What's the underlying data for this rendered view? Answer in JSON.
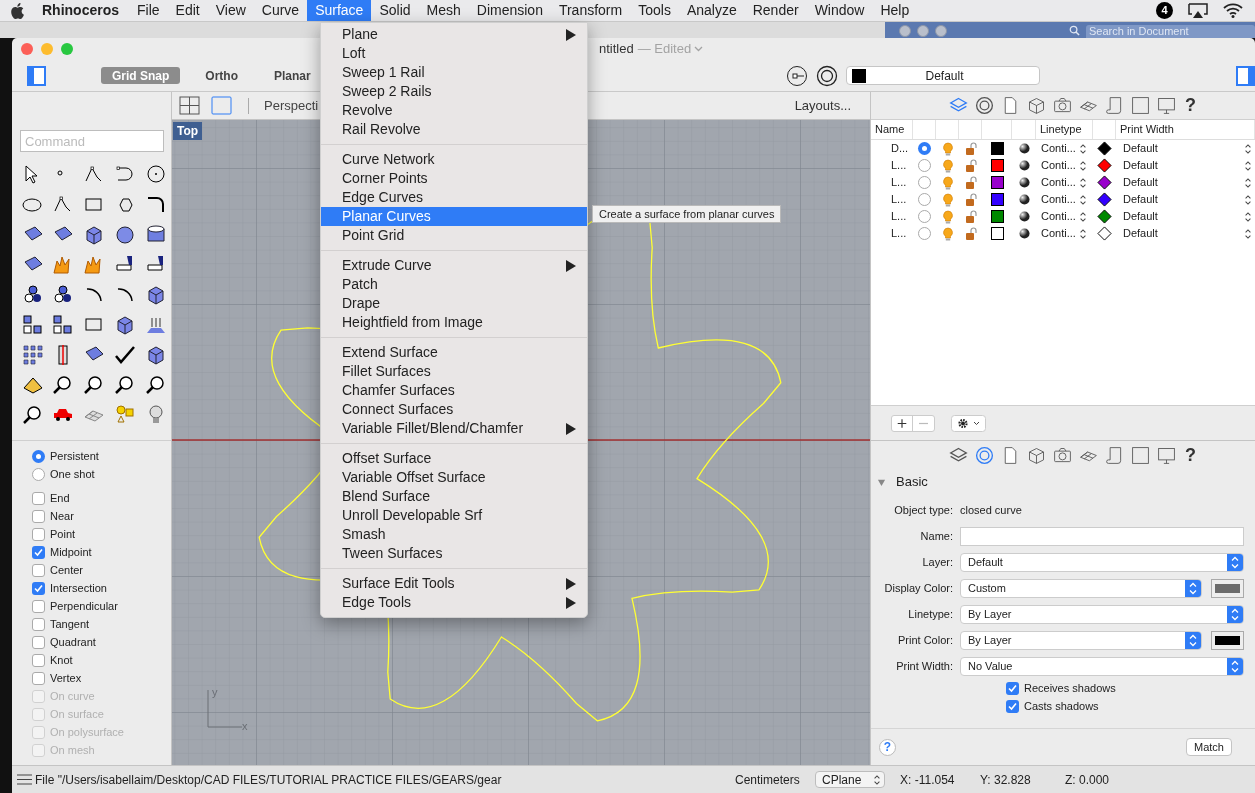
{
  "menu_bar": {
    "app": "Rhinoceros",
    "items": [
      {
        "label": "File",
        "selected": false
      },
      {
        "label": "Edit",
        "selected": false
      },
      {
        "label": "View",
        "selected": false
      },
      {
        "label": "Curve",
        "selected": false
      },
      {
        "label": "Surface",
        "selected": true
      },
      {
        "label": "Solid",
        "selected": false
      },
      {
        "label": "Mesh",
        "selected": false
      },
      {
        "label": "Dimension",
        "selected": false
      },
      {
        "label": "Transform",
        "selected": false
      },
      {
        "label": "Tools",
        "selected": false
      },
      {
        "label": "Analyze",
        "selected": false
      },
      {
        "label": "Render",
        "selected": false
      },
      {
        "label": "Window",
        "selected": false
      },
      {
        "label": "Help",
        "selected": false
      }
    ],
    "notification_count": "4"
  },
  "background_window": {
    "search_placeholder": "Search in Document"
  },
  "window": {
    "title": "ntitled",
    "status": "— Edited"
  },
  "toolbar": {
    "toggles": [
      {
        "label": "Grid Snap",
        "on": true
      },
      {
        "label": "Ortho",
        "on": false
      },
      {
        "label": "Planar",
        "on": false
      }
    ],
    "layer": {
      "label": "Default",
      "color": "#000000"
    }
  },
  "command": {
    "placeholder": "Command"
  },
  "osnap": {
    "modes": [
      {
        "label": "Persistent",
        "selected": true
      },
      {
        "label": "One shot",
        "selected": false
      }
    ],
    "snaps": [
      {
        "label": "End",
        "checked": false,
        "disabled": false
      },
      {
        "label": "Near",
        "checked": false,
        "disabled": false
      },
      {
        "label": "Point",
        "checked": false,
        "disabled": false
      },
      {
        "label": "Midpoint",
        "checked": true,
        "disabled": false
      },
      {
        "label": "Center",
        "checked": false,
        "disabled": false
      },
      {
        "label": "Intersection",
        "checked": true,
        "disabled": false
      },
      {
        "label": "Perpendicular",
        "checked": false,
        "disabled": false
      },
      {
        "label": "Tangent",
        "checked": false,
        "disabled": false
      },
      {
        "label": "Quadrant",
        "checked": false,
        "disabled": false
      },
      {
        "label": "Knot",
        "checked": false,
        "disabled": false
      },
      {
        "label": "Vertex",
        "checked": false,
        "disabled": false
      },
      {
        "label": "On curve",
        "checked": false,
        "disabled": true
      },
      {
        "label": "On surface",
        "checked": false,
        "disabled": true
      },
      {
        "label": "On polysurface",
        "checked": false,
        "disabled": true
      },
      {
        "label": "On mesh",
        "checked": false,
        "disabled": true
      }
    ]
  },
  "viewport": {
    "views": [
      {
        "selected": false
      },
      {
        "selected": true
      }
    ],
    "tab": "Perspecti",
    "layouts": "Layouts...",
    "name": "Top",
    "axis_x": "x",
    "axis_y": "y"
  },
  "layers": {
    "tabs": [
      {
        "selected": true
      },
      {
        "selected": false
      },
      {
        "selected": false
      },
      {
        "selected": false
      },
      {
        "selected": false
      },
      {
        "selected": false
      },
      {
        "selected": false
      },
      {
        "selected": false
      },
      {
        "selected": false
      }
    ],
    "help": "?",
    "columns": [
      "Name",
      "Linetype",
      "Print Width"
    ],
    "rows": [
      {
        "name": "D...",
        "current": true,
        "color": "#000000",
        "linetype": "Conti...",
        "print_color": {
          "color": "#000000"
        },
        "print_width": "Default"
      },
      {
        "name": "L...",
        "current": false,
        "color": "#ff0000",
        "linetype": "Conti...",
        "print_color": {
          "color": "#ff0000"
        },
        "print_width": "Default"
      },
      {
        "name": "L...",
        "current": false,
        "color": "#9900cc",
        "linetype": "Conti...",
        "print_color": {
          "color": "#9900cc"
        },
        "print_width": "Default"
      },
      {
        "name": "L...",
        "current": false,
        "color": "#3300ff",
        "linetype": "Conti...",
        "print_color": {
          "color": "#3300ff"
        },
        "print_width": "Default"
      },
      {
        "name": "L...",
        "current": false,
        "color": "#008800",
        "linetype": "Conti...",
        "print_color": {
          "color": "#008800"
        },
        "print_width": "Default"
      },
      {
        "name": "L...",
        "current": false,
        "color": "#ffffff",
        "linetype": "Conti...",
        "print_color": {
          "color": "#ffffff"
        },
        "print_width": "Default"
      }
    ]
  },
  "properties": {
    "tabs": [
      {
        "selected": false
      },
      {
        "selected": true
      },
      {
        "selected": false
      },
      {
        "selected": false
      },
      {
        "selected": false
      },
      {
        "selected": false
      },
      {
        "selected": false
      },
      {
        "selected": false
      },
      {
        "selected": false
      }
    ],
    "help": "?",
    "section": "Basic",
    "expanded": true,
    "object_type_label": "Object type:",
    "object_type": "closed curve",
    "fields": [
      {
        "label": "Name:",
        "kind": "text"
      },
      {
        "label": "Layer:",
        "kind": "select",
        "value": "Default"
      },
      {
        "label": "Display Color:",
        "kind": "select",
        "value": "Custom",
        "swatch": {
          "color": "#6b6b6b"
        }
      },
      {
        "label": "Linetype:",
        "kind": "select",
        "value": "By Layer"
      },
      {
        "label": "Print Color:",
        "kind": "select",
        "value": "By Layer",
        "swatch": {
          "color": "#000000"
        }
      },
      {
        "label": "Print Width:",
        "kind": "select",
        "value": "No Value"
      }
    ],
    "checkboxes": [
      {
        "label": "Receives shadows",
        "checked": true
      },
      {
        "label": "Casts shadows",
        "checked": true
      }
    ],
    "help_button": "?",
    "button": "Match"
  },
  "status_bar": {
    "file": "File \"/Users/isabellaim/Desktop/CAD FILES/TUTORIAL PRACTICE FILES/GEARS/gear",
    "units": "Centimeters",
    "cplane": "CPlane",
    "x": "X: -11.054",
    "y": "Y: 32.828",
    "z": "Z: 0.000"
  },
  "surface_menu": {
    "groups": [
      [
        {
          "label": "Plane",
          "submenu": true,
          "selected": false
        },
        {
          "label": "Loft",
          "submenu": false,
          "selected": false
        },
        {
          "label": "Sweep 1 Rail",
          "submenu": false,
          "selected": false
        },
        {
          "label": "Sweep 2 Rails",
          "submenu": false,
          "selected": false
        },
        {
          "label": "Revolve",
          "submenu": false,
          "selected": false
        },
        {
          "label": "Rail Revolve",
          "submenu": false,
          "selected": false
        }
      ],
      [
        {
          "label": "Curve Network",
          "submenu": false,
          "selected": false
        },
        {
          "label": "Corner Points",
          "submenu": false,
          "selected": false
        },
        {
          "label": "Edge Curves",
          "submenu": false,
          "selected": false
        },
        {
          "label": "Planar Curves",
          "submenu": false,
          "selected": true
        },
        {
          "label": "Point Grid",
          "submenu": false,
          "selected": false
        }
      ],
      [
        {
          "label": "Extrude Curve",
          "submenu": true,
          "selected": false
        },
        {
          "label": "Patch",
          "submenu": false,
          "selected": false
        },
        {
          "label": "Drape",
          "submenu": false,
          "selected": false
        },
        {
          "label": "Heightfield from Image",
          "submenu": false,
          "selected": false
        }
      ],
      [
        {
          "label": "Extend Surface",
          "submenu": false,
          "selected": false
        },
        {
          "label": "Fillet Surfaces",
          "submenu": false,
          "selected": false
        },
        {
          "label": "Chamfer Surfaces",
          "submenu": false,
          "selected": false
        },
        {
          "label": "Connect Surfaces",
          "submenu": false,
          "selected": false
        },
        {
          "label": "Variable Fillet/Blend/Chamfer",
          "submenu": true,
          "selected": false
        }
      ],
      [
        {
          "label": "Offset Surface",
          "submenu": false,
          "selected": false
        },
        {
          "label": "Variable Offset Surface",
          "submenu": false,
          "selected": false
        },
        {
          "label": "Blend Surface",
          "submenu": false,
          "selected": false
        },
        {
          "label": "Unroll Developable Srf",
          "submenu": false,
          "selected": false
        },
        {
          "label": "Smash",
          "submenu": false,
          "selected": false
        },
        {
          "label": "Tween Surfaces",
          "submenu": false,
          "selected": false
        }
      ],
      [
        {
          "label": "Surface Edit Tools",
          "submenu": true,
          "selected": false
        },
        {
          "label": "Edge Tools",
          "submenu": true,
          "selected": false
        }
      ]
    ],
    "tooltip": "Create a surface from planar curves"
  }
}
